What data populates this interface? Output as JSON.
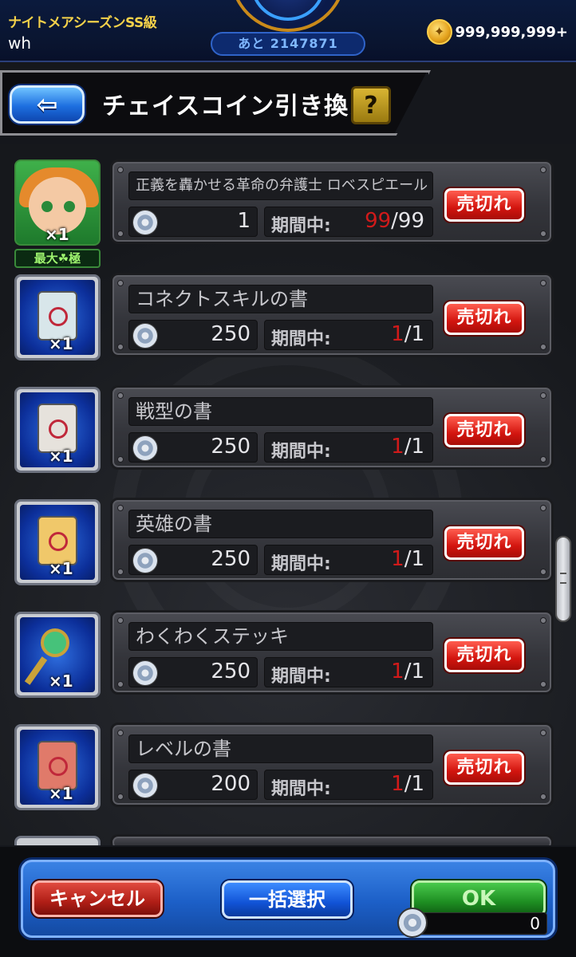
{
  "status": {
    "season": "ナイトメアシーズンSS級",
    "user": "wh",
    "remaining": "あと 2147871",
    "coins": "999,999,999+"
  },
  "header": {
    "back_label": "⇦",
    "title": "チェイスコイン引き換え",
    "help_label": "?"
  },
  "items": [
    {
      "name": "正義を轟かせる革命の弁護士 ロベスピエール",
      "clover": "☘ 1",
      "qty": "×1",
      "badge": "最大☘極",
      "cost": "1",
      "period_label": "期間中:",
      "period_cur": "99",
      "period_max": "/99",
      "button": "売切れ"
    },
    {
      "name": "コネクトスキルの書",
      "qty": "×1",
      "cost": "250",
      "period_label": "期間中:",
      "period_cur": "1",
      "period_max": "/1",
      "button": "売切れ",
      "icon": "scroll-icon"
    },
    {
      "name": "戦型の書",
      "qty": "×1",
      "cost": "250",
      "period_label": "期間中:",
      "period_cur": "1",
      "period_max": "/1",
      "button": "売切れ",
      "icon": "scroll-icon"
    },
    {
      "name": "英雄の書",
      "qty": "×1",
      "cost": "250",
      "period_label": "期間中:",
      "period_cur": "1",
      "period_max": "/1",
      "button": "売切れ",
      "icon": "scroll-icon"
    },
    {
      "name": "わくわくステッキ",
      "qty": "×1",
      "cost": "250",
      "period_label": "期間中:",
      "period_cur": "1",
      "period_max": "/1",
      "button": "売切れ",
      "icon": "wand-icon"
    },
    {
      "name": "レベルの書",
      "qty": "×1",
      "cost": "200",
      "period_label": "期間中:",
      "period_cur": "1",
      "period_max": "/1",
      "button": "売切れ",
      "icon": "scroll-icon"
    }
  ],
  "footer": {
    "cancel": "キャンセル",
    "bulk_select": "一括選択",
    "ok": "OK",
    "total": "0"
  },
  "colors": {
    "sold_out": "#d3150f",
    "period_current": "#d11a1a",
    "clover_green": "#4fd34a"
  }
}
